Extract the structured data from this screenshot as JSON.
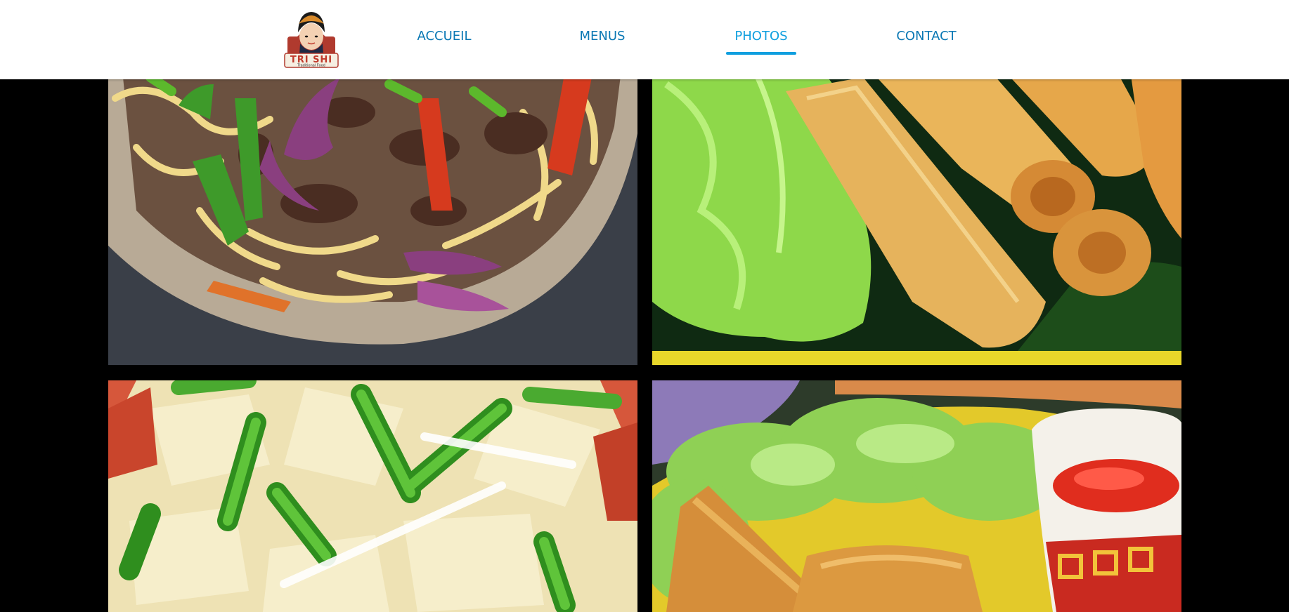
{
  "brand": {
    "logo_name": "TRI SHI",
    "logo_tagline": "Traditional Food"
  },
  "nav": {
    "items": [
      {
        "label": "ACCUEIL",
        "active": false
      },
      {
        "label": "MENUS",
        "active": false
      },
      {
        "label": "PHOTOS",
        "active": true
      },
      {
        "label": "CONTACT",
        "active": false
      }
    ]
  },
  "colors": {
    "nav_text": "#0a78b4",
    "nav_active": "#0f9fdf",
    "page_background": "#000000"
  },
  "gallery": {
    "photos": [
      {
        "subject": "stir-fried beef udon with peppers and onions"
      },
      {
        "subject": "fried spring rolls with lettuce"
      },
      {
        "subject": "sliced omelette with green onions"
      },
      {
        "subject": "fried samosas with lettuce and chili sauce"
      }
    ]
  }
}
